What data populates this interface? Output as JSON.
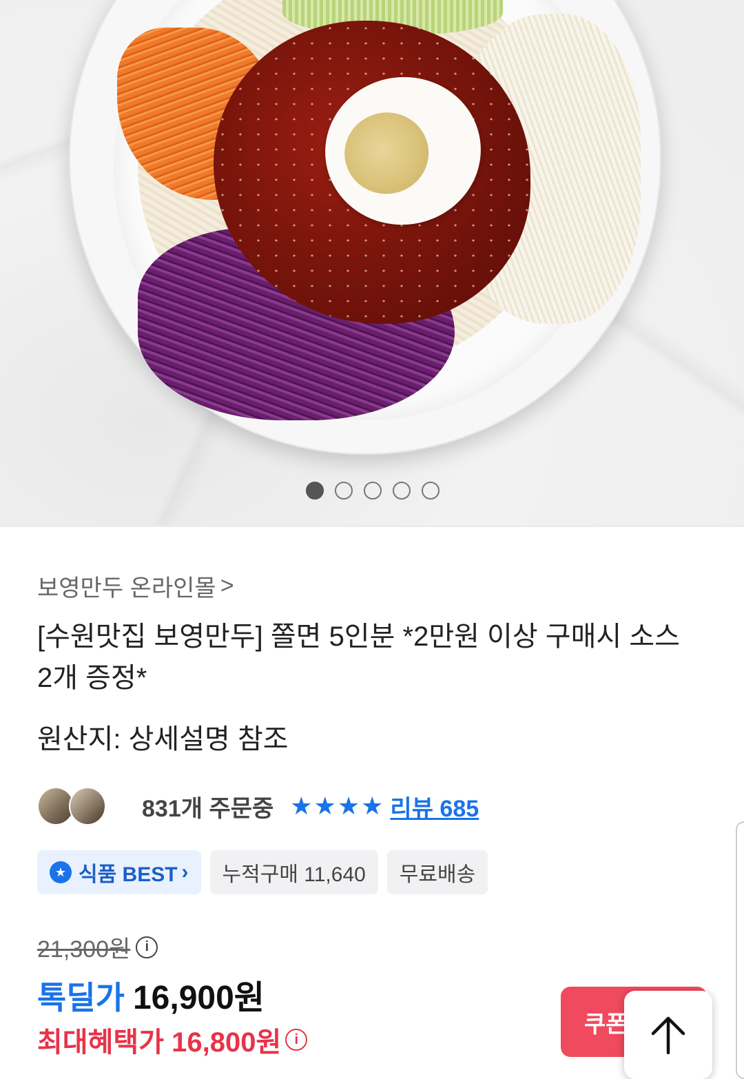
{
  "gallery": {
    "image_alt": "쫄면 product photo",
    "dots": [
      true,
      false,
      false,
      false,
      false
    ]
  },
  "store": {
    "name": "보영만두 온라인몰",
    "chevron": ">"
  },
  "product": {
    "title": "[수원맛집 보영만두] 쫄면 5인분 *2만원 이상 구매시 소스 2개 증정*",
    "origin": "원산지: 상세설명 참조"
  },
  "social": {
    "orders": "831개 주문중",
    "rating_stars": 4,
    "review_label": "리뷰 685"
  },
  "chips": {
    "best": "식품 BEST",
    "cumulative": "누적구매 11,640",
    "shipping": "무료배송"
  },
  "price": {
    "original": "21,300원",
    "deal_label": "톡딜가",
    "deal_price": "16,900원",
    "max_benefit": "최대혜택가 16,800원"
  },
  "actions": {
    "coupon_label": "쿠폰"
  },
  "colors": {
    "accent_blue": "#1a73e8",
    "accent_red": "#e8334a",
    "coupon_bg": "#f04a5e"
  }
}
